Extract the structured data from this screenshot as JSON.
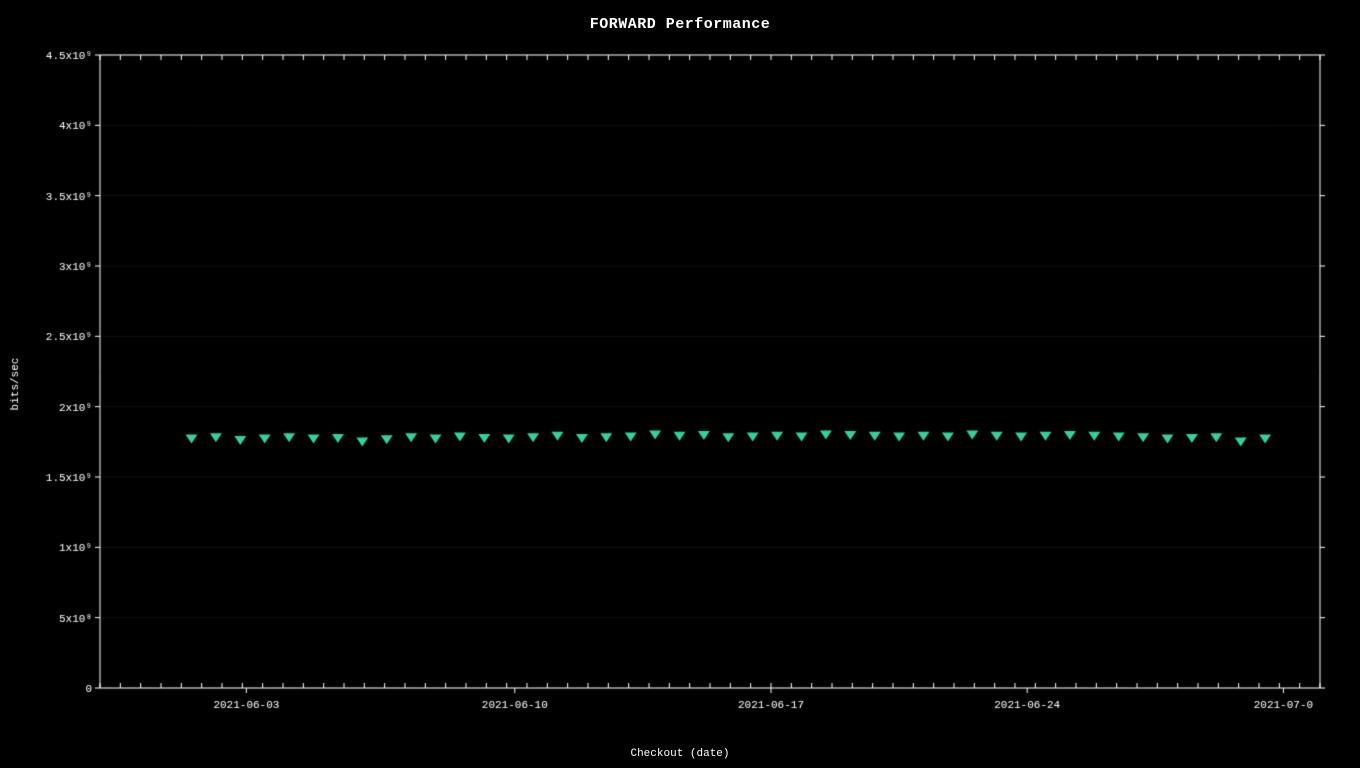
{
  "chart": {
    "title": "FORWARD Performance",
    "x_axis_label": "Checkout (date)",
    "y_axis_label": "bits/sec",
    "background_color": "#000000",
    "data_color": "#2dd4a0",
    "grid_color": "#333333",
    "tick_color": "#ffffff",
    "y_axis": {
      "min": 0,
      "max": 4500000000,
      "ticks": [
        {
          "value": 0,
          "label": "0"
        },
        {
          "value": 500000000,
          "label": "5x10⁸"
        },
        {
          "value": 1000000000,
          "label": "1x10⁹"
        },
        {
          "value": 1500000000,
          "label": "1.5x10⁹"
        },
        {
          "value": 2000000000,
          "label": "2x10⁹"
        },
        {
          "value": 2500000000,
          "label": "2.5x10⁹"
        },
        {
          "value": 3000000000,
          "label": "3x10⁹"
        },
        {
          "value": 3500000000,
          "label": "3.5x10⁹"
        },
        {
          "value": 4000000000,
          "label": "4x10⁹"
        },
        {
          "value": 4500000000,
          "label": "4.5x10⁹"
        }
      ]
    },
    "x_axis": {
      "ticks": [
        {
          "label": "2021-06-03",
          "x_frac": 0.12
        },
        {
          "label": "2021-06-10",
          "x_frac": 0.34
        },
        {
          "label": "2021-06-17",
          "x_frac": 0.55
        },
        {
          "label": "2021-06-24",
          "x_frac": 0.76
        },
        {
          "label": "2021-07-0",
          "x_frac": 0.97
        }
      ]
    },
    "data_points": [
      {
        "x_frac": 0.075,
        "value": 1780000000
      },
      {
        "x_frac": 0.095,
        "value": 1790000000
      },
      {
        "x_frac": 0.115,
        "value": 1770000000
      },
      {
        "x_frac": 0.135,
        "value": 1780000000
      },
      {
        "x_frac": 0.155,
        "value": 1790000000
      },
      {
        "x_frac": 0.175,
        "value": 1780000000
      },
      {
        "x_frac": 0.195,
        "value": 1785000000
      },
      {
        "x_frac": 0.215,
        "value": 1760000000
      },
      {
        "x_frac": 0.235,
        "value": 1775000000
      },
      {
        "x_frac": 0.255,
        "value": 1790000000
      },
      {
        "x_frac": 0.275,
        "value": 1780000000
      },
      {
        "x_frac": 0.295,
        "value": 1795000000
      },
      {
        "x_frac": 0.315,
        "value": 1785000000
      },
      {
        "x_frac": 0.335,
        "value": 1780000000
      },
      {
        "x_frac": 0.355,
        "value": 1790000000
      },
      {
        "x_frac": 0.375,
        "value": 1800000000
      },
      {
        "x_frac": 0.395,
        "value": 1785000000
      },
      {
        "x_frac": 0.415,
        "value": 1790000000
      },
      {
        "x_frac": 0.435,
        "value": 1795000000
      },
      {
        "x_frac": 0.455,
        "value": 1810000000
      },
      {
        "x_frac": 0.475,
        "value": 1800000000
      },
      {
        "x_frac": 0.495,
        "value": 1805000000
      },
      {
        "x_frac": 0.515,
        "value": 1790000000
      },
      {
        "x_frac": 0.535,
        "value": 1795000000
      },
      {
        "x_frac": 0.555,
        "value": 1800000000
      },
      {
        "x_frac": 0.575,
        "value": 1795000000
      },
      {
        "x_frac": 0.595,
        "value": 1810000000
      },
      {
        "x_frac": 0.615,
        "value": 1805000000
      },
      {
        "x_frac": 0.635,
        "value": 1800000000
      },
      {
        "x_frac": 0.655,
        "value": 1795000000
      },
      {
        "x_frac": 0.675,
        "value": 1800000000
      },
      {
        "x_frac": 0.695,
        "value": 1795000000
      },
      {
        "x_frac": 0.715,
        "value": 1810000000
      },
      {
        "x_frac": 0.735,
        "value": 1800000000
      },
      {
        "x_frac": 0.755,
        "value": 1795000000
      },
      {
        "x_frac": 0.775,
        "value": 1800000000
      },
      {
        "x_frac": 0.795,
        "value": 1805000000
      },
      {
        "x_frac": 0.815,
        "value": 1800000000
      },
      {
        "x_frac": 0.835,
        "value": 1795000000
      },
      {
        "x_frac": 0.855,
        "value": 1790000000
      },
      {
        "x_frac": 0.875,
        "value": 1780000000
      },
      {
        "x_frac": 0.895,
        "value": 1785000000
      },
      {
        "x_frac": 0.915,
        "value": 1790000000
      },
      {
        "x_frac": 0.935,
        "value": 1760000000
      },
      {
        "x_frac": 0.955,
        "value": 1780000000
      }
    ]
  }
}
